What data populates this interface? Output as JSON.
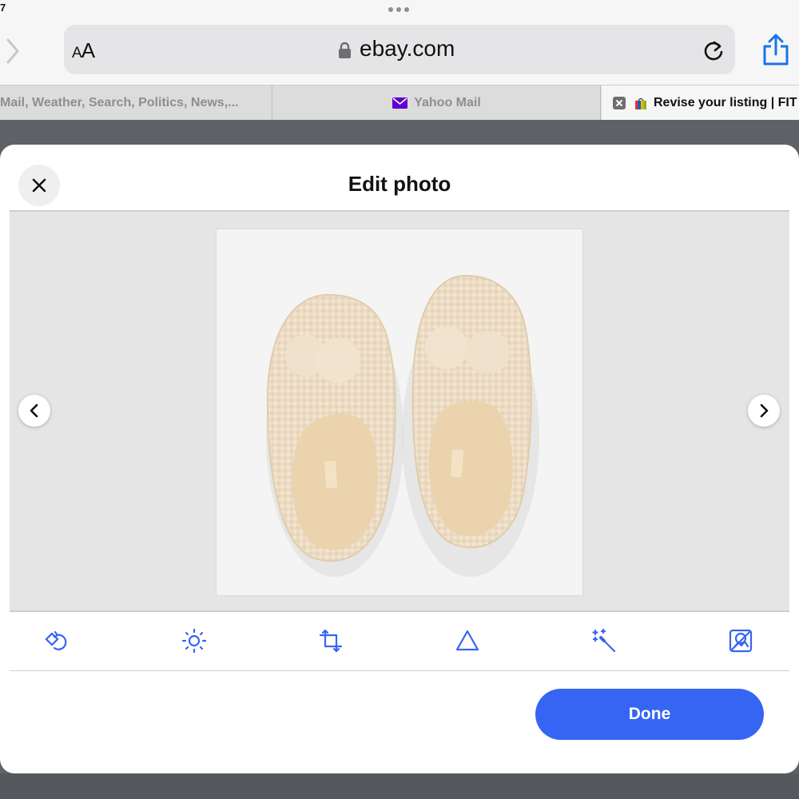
{
  "status_bar": {
    "clock_fragment": "7"
  },
  "browser": {
    "aa_label_small": "A",
    "aa_label_large": "A",
    "url": "ebay.com",
    "tabs": [
      {
        "label": "Mail, Weather, Search, Politics, News,..."
      },
      {
        "label": "Yahoo Mail",
        "icon": "yahoo-mail-icon"
      },
      {
        "label": "Revise your listing | FIT",
        "icon": "ebay-favicon",
        "active": true
      }
    ]
  },
  "modal": {
    "title": "Edit photo",
    "photo_subject": "slippers-photo",
    "tools": [
      {
        "name": "rotate-icon"
      },
      {
        "name": "brightness-icon"
      },
      {
        "name": "crop-icon"
      },
      {
        "name": "contrast-icon"
      },
      {
        "name": "magic-wand-icon"
      },
      {
        "name": "remove-background-icon"
      }
    ],
    "done_label": "Done"
  },
  "colors": {
    "accent": "#3665f3",
    "modal_bg": "#ffffff",
    "overlay": "#5e6266"
  }
}
